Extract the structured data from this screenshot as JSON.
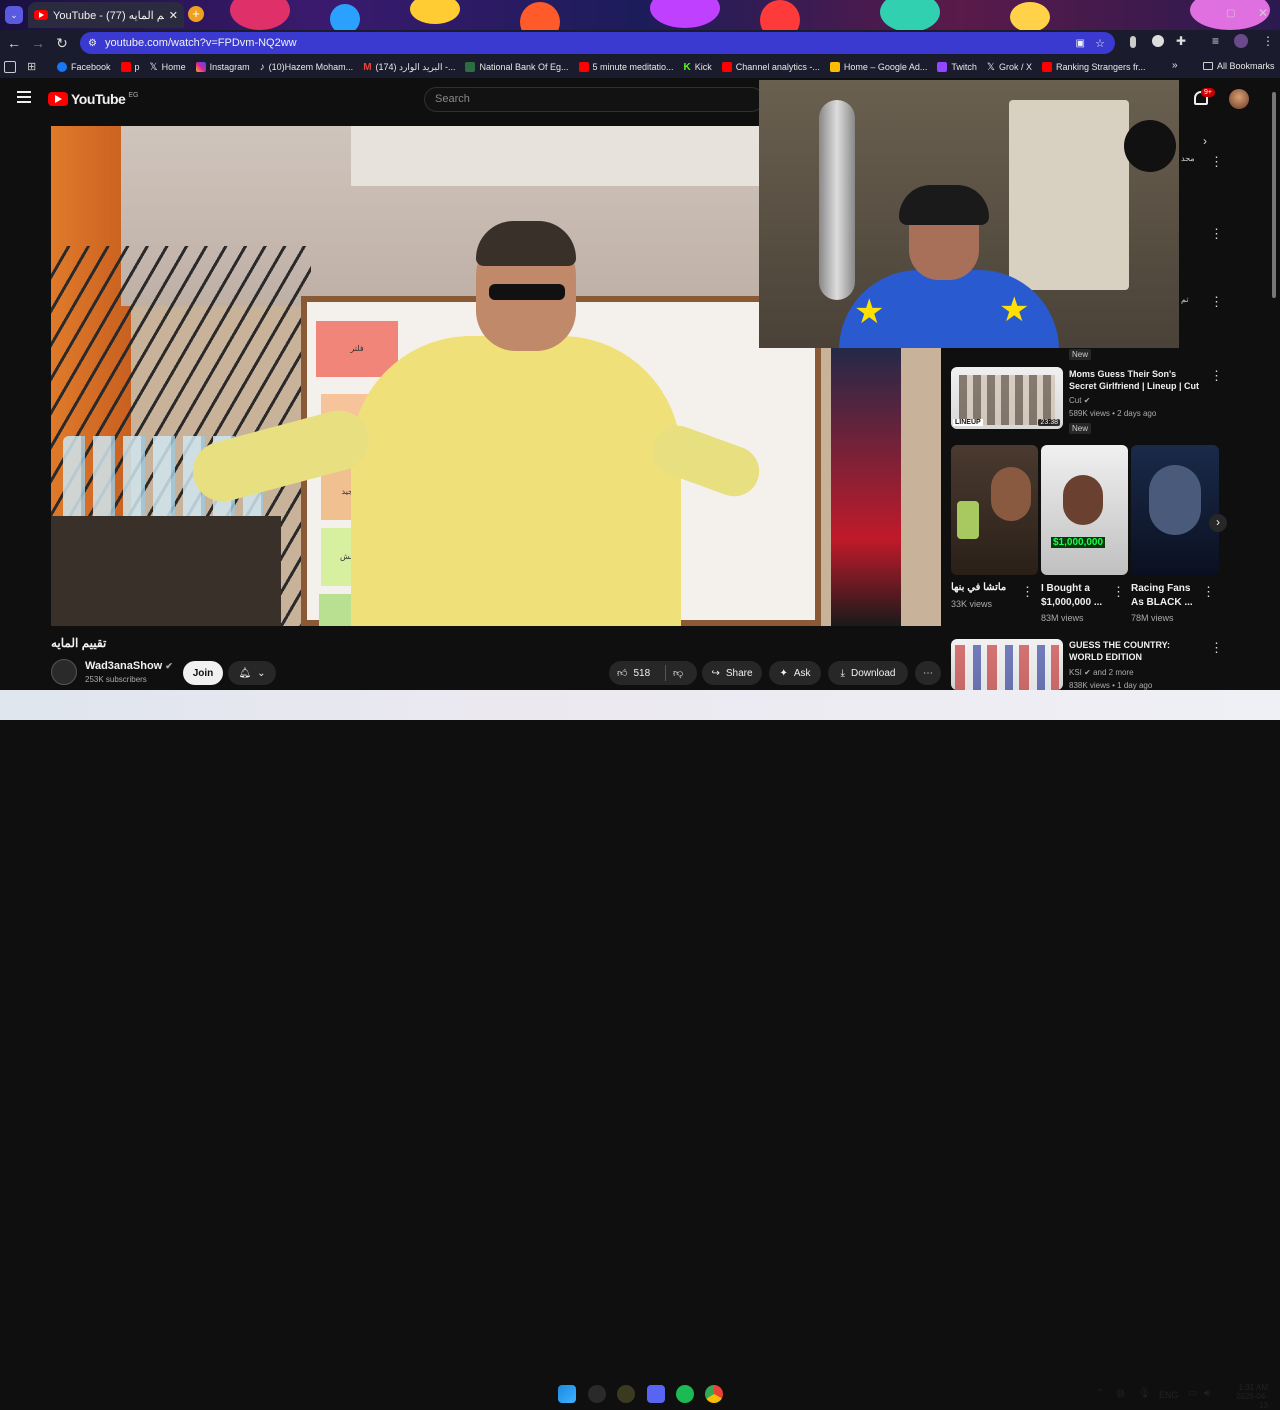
{
  "browser": {
    "tab_title": "YouTube - تقييم المايه (77)",
    "url": "youtube.com/watch?v=FPDvm-NQ2ww",
    "bookmarks": [
      "Facebook",
      "p",
      "Home",
      "Instagram",
      "(10)Hazem Moham...",
      "(174) البريد الوارد -...",
      "National Bank Of Eg...",
      "5 minute meditatio...",
      "Kick",
      "Channel analytics -...",
      "Home – Google Ad...",
      "Twitch",
      "Grok / X",
      "Ranking Strangers fr..."
    ],
    "all_bookmarks": "All Bookmarks"
  },
  "youtube": {
    "logo": "YouTube",
    "region": "EG",
    "search_placeholder": "Search",
    "notif_count": "9+",
    "video_title": "تقييم المايه",
    "channel_name": "Wad3anaShow",
    "subscribers": "253K subscribers",
    "join": "Join",
    "likes": "518",
    "share": "Share",
    "ask": "Ask",
    "download": "Download",
    "board_notes": [
      "فلتر",
      "شغال مجيد",
      "مع بس مش"
    ],
    "recs": [
      {
        "title": "Moms Guess Their Son's Secret Girlfriend | Lineup | Cut",
        "channel": "Cut",
        "meta": "589K views • 2 days ago",
        "badge": "New",
        "duration": "23:38",
        "thumb_text": "LINEUP"
      },
      {
        "title": "GUESS THE COUNTRY: WORLD EDITION",
        "channel": "KSI",
        "channel_extra": "and 2 more",
        "meta": "838K views • 1 day ago"
      }
    ],
    "shorts": [
      {
        "title": "ماتشا في بنها",
        "views": "33K views"
      },
      {
        "title": "I Bought a $1,000,000 ...",
        "views": "83M views",
        "thumb_text": "$1,000,000"
      },
      {
        "title": "Racing Fans As BLACK ...",
        "views": "78M views"
      }
    ],
    "above_badge": "New",
    "side_right_text": "محد",
    "side_right_text2": "تم"
  },
  "taskbar": {
    "lang": "ENG",
    "time": "1:31 AM",
    "date": "2026-04-13"
  }
}
